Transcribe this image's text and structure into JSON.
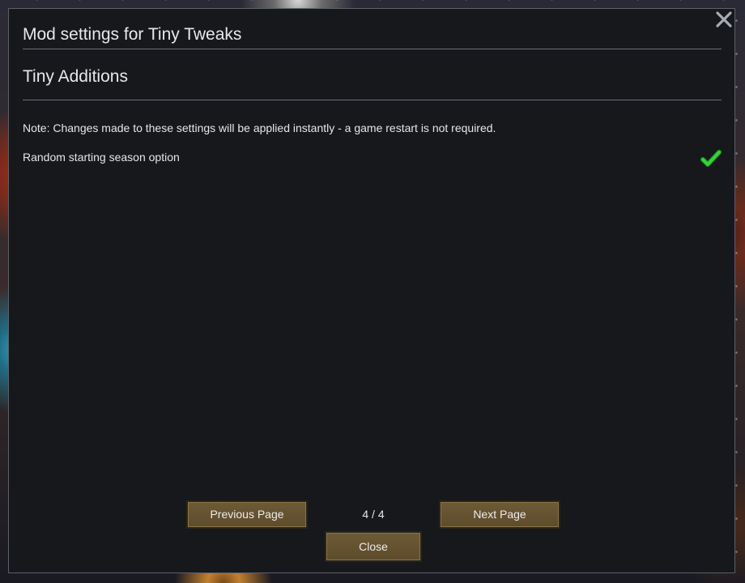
{
  "dialog": {
    "title": "Mod settings for Tiny Tweaks",
    "section_title": "Tiny Additions",
    "note": "Note: Changes made to these settings will be applied instantly - a game restart is not required.",
    "settings": [
      {
        "label": "Random starting season option",
        "enabled": true,
        "icon": "checkmark-icon"
      }
    ],
    "close_icon": "close-icon"
  },
  "pagination": {
    "previous_label": "Previous Page",
    "next_label": "Next Page",
    "indicator": "4 / 4"
  },
  "footer": {
    "close_label": "Close"
  },
  "colors": {
    "dialog_bg": "#16181c",
    "button_bg": "#6e5a36",
    "check_green": "#2fcf2f",
    "text": "#e6e6e6"
  }
}
